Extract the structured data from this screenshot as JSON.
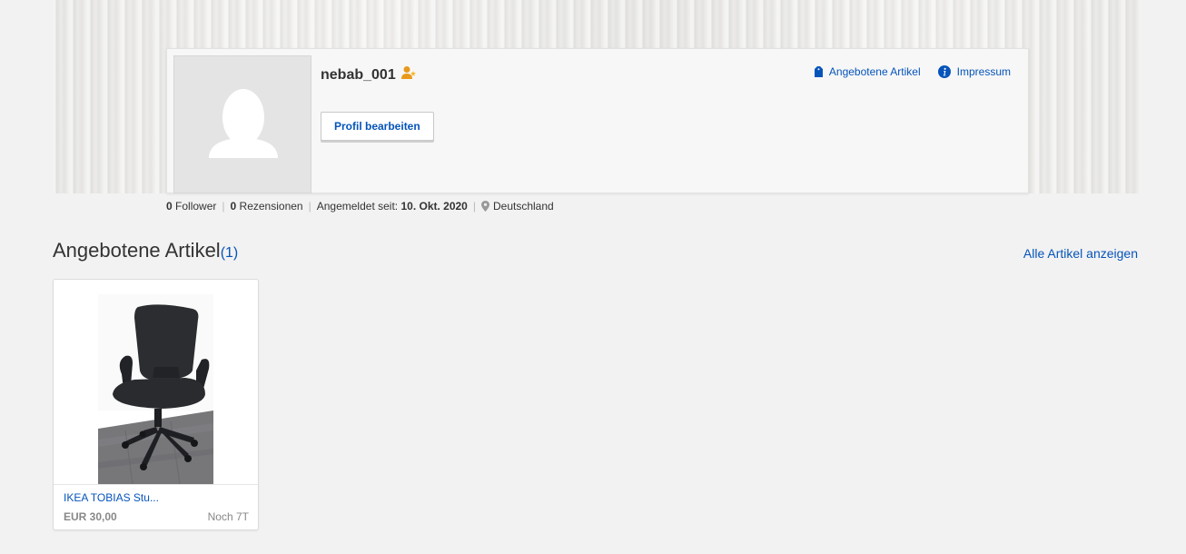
{
  "profile": {
    "username": "nebab_001",
    "edit_button_label": "Profil bearbeiten",
    "links": {
      "offered_items": "Angebotene Artikel",
      "imprint": "Impressum"
    },
    "stats": {
      "followers_count": "0",
      "followers_label": "Follower",
      "reviews_count": "0",
      "reviews_label": "Rezensionen",
      "registered_label": "Angemeldet seit:",
      "registered_date": "10. Okt. 2020",
      "location": "Deutschland"
    }
  },
  "section": {
    "title": "Angebotene Artikel",
    "count": "(1)",
    "show_all_label": "Alle Artikel anzeigen"
  },
  "items": [
    {
      "title": "IKEA TOBIAS Stu...",
      "price": "EUR 30,00",
      "time_left": "Noch 7T"
    }
  ],
  "icons": {
    "avatar": "person-silhouette-icon",
    "badge": "new-user-badge-icon",
    "offered_items": "tag-icon",
    "imprint": "info-icon",
    "location": "location-pin-icon"
  },
  "colors": {
    "link": "#0654ba",
    "badge": "#e89a1c",
    "muted": "#888888"
  }
}
